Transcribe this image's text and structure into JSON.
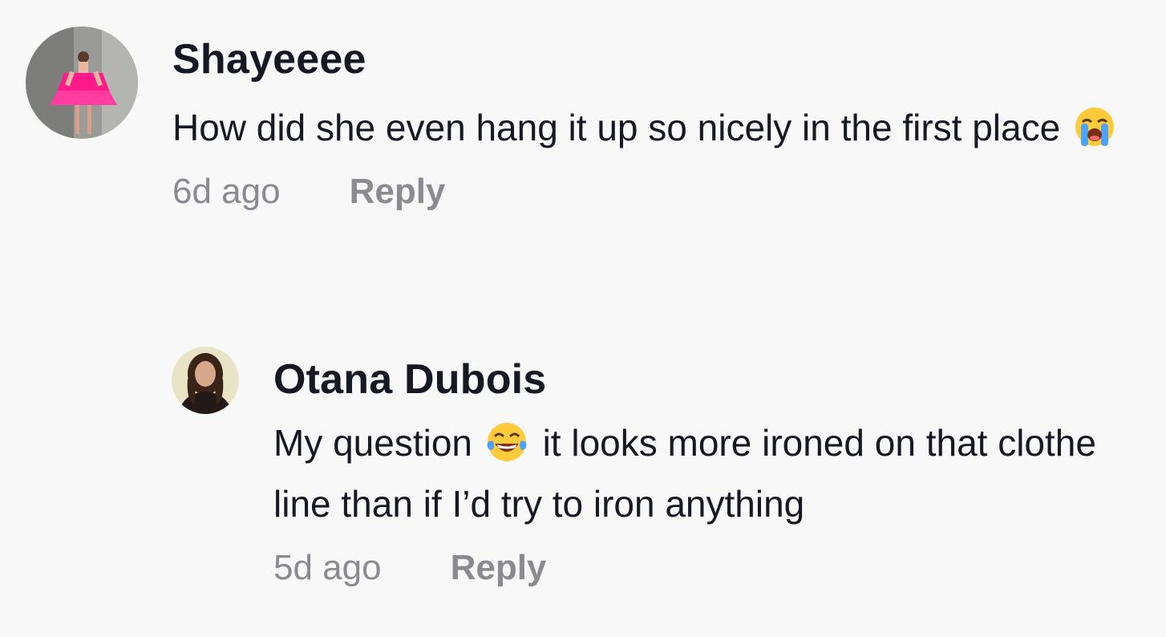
{
  "comments": [
    {
      "username": "Shayeeee",
      "text_before": "How did she even hang it up so nicely in the first place",
      "emoji": "loudly-crying-face",
      "text_after": "",
      "time": "6d ago",
      "reply_label": "Reply"
    },
    {
      "username": "Otana Dubois",
      "text_before": "My question",
      "emoji": "face-with-tears-of-joy",
      "text_after": "it looks more ironed on that clothe line than if I’d try to iron anything",
      "time": "5d ago",
      "reply_label": "Reply"
    }
  ],
  "colors": {
    "background": "#f8f8f8",
    "text": "#161823",
    "muted": "#8a8b91"
  }
}
